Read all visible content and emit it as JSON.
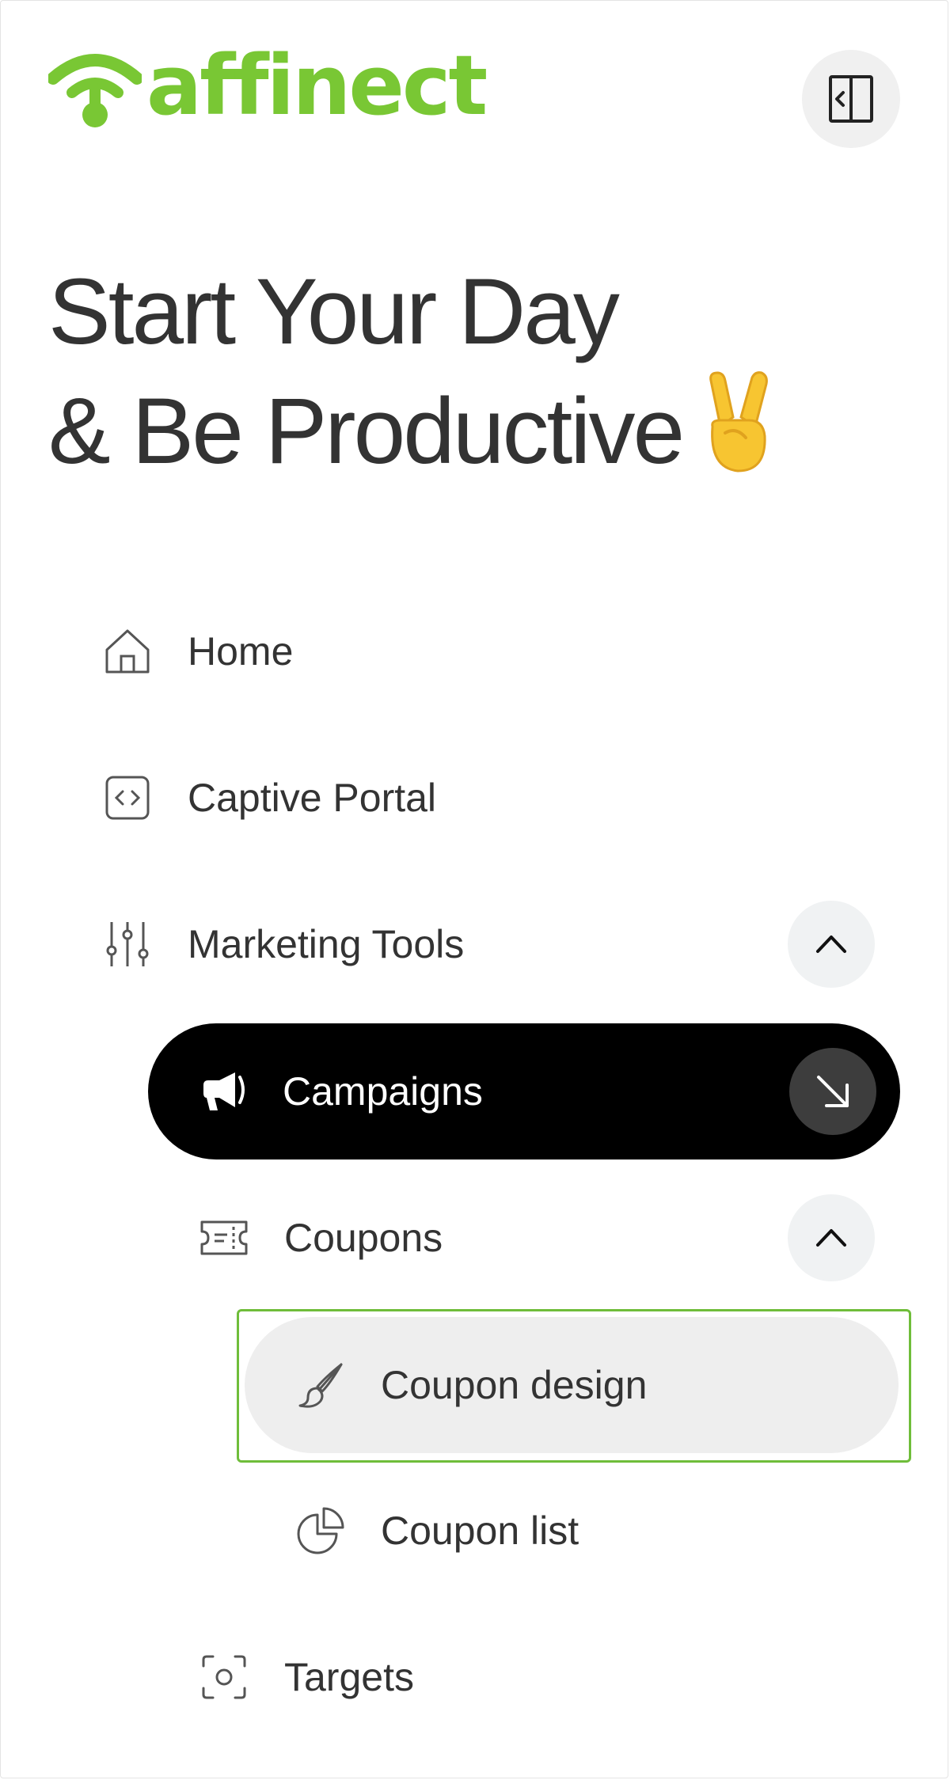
{
  "brand": {
    "name": "affinect",
    "color": "#79c734",
    "logo_icon": "wifi-signal-icon"
  },
  "header": {
    "collapse_icon": "sidebar-collapse-icon"
  },
  "greeting": {
    "line1": "Start Your Day",
    "line2": "& Be Productive",
    "emoji": "victory-hand-emoji"
  },
  "nav": {
    "home": {
      "label": "Home",
      "icon": "home-icon"
    },
    "captive_portal": {
      "label": "Captive Portal",
      "icon": "code-brackets-icon"
    },
    "marketing_tools": {
      "label": "Marketing Tools",
      "icon": "sliders-icon",
      "expanded": true
    },
    "campaigns": {
      "label": "Campaigns",
      "icon": "megaphone-icon",
      "active": true,
      "action_icon": "arrow-down-right-icon"
    },
    "coupons": {
      "label": "Coupons",
      "icon": "ticket-icon",
      "expanded": true
    },
    "coupon_design": {
      "label": "Coupon design",
      "icon": "paintbrush-icon",
      "hovered": true
    },
    "coupon_list": {
      "label": "Coupon list",
      "icon": "pie-chart-icon"
    },
    "targets": {
      "label": "Targets",
      "icon": "target-scan-icon"
    }
  },
  "colors": {
    "active_bg": "#000000",
    "hover_bg": "#eeeeee",
    "focus_outline": "#6fbd3a",
    "text": "#333333"
  }
}
